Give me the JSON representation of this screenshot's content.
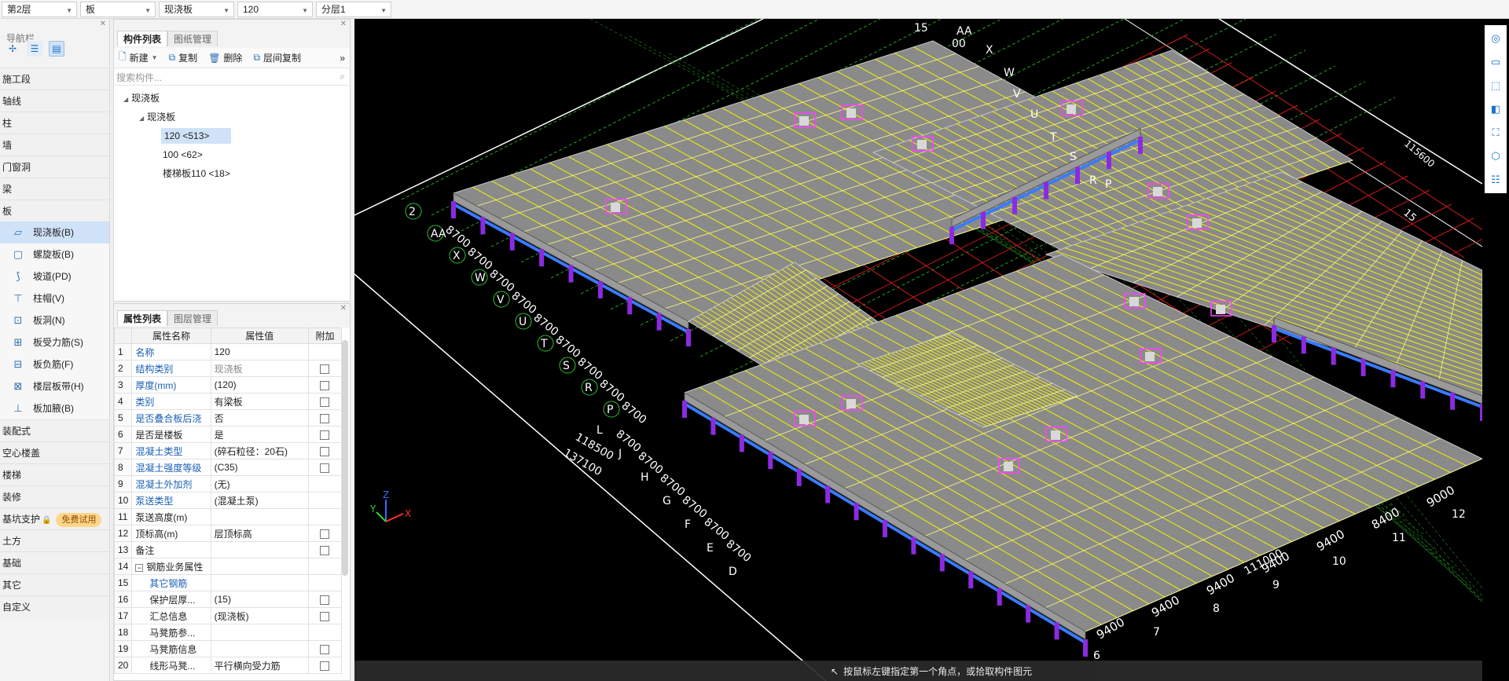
{
  "topbar": {
    "floor": "第2层",
    "category": "板",
    "type": "现浇板",
    "component": "120",
    "sublayer": "分层1"
  },
  "nav": {
    "title": "导航栏",
    "categories": [
      {
        "label": "施工段"
      },
      {
        "label": "轴线"
      },
      {
        "label": "柱"
      },
      {
        "label": "墙"
      },
      {
        "label": "门窗洞"
      },
      {
        "label": "梁"
      },
      {
        "label": "板"
      }
    ],
    "board_items": [
      {
        "label": "现浇板(B)",
        "icon": "slab-icon"
      },
      {
        "label": "螺旋板(B)",
        "icon": "spiral-slab-icon"
      },
      {
        "label": "坡道(PD)",
        "icon": "ramp-icon"
      },
      {
        "label": "柱帽(V)",
        "icon": "column-cap-icon"
      },
      {
        "label": "板洞(N)",
        "icon": "slab-hole-icon"
      },
      {
        "label": "板受力筋(S)",
        "icon": "slab-rebar-icon"
      },
      {
        "label": "板负筋(F)",
        "icon": "negative-rebar-icon"
      },
      {
        "label": "楼层板带(H)",
        "icon": "slab-strip-icon"
      },
      {
        "label": "板加腋(B)",
        "icon": "haunch-icon"
      }
    ],
    "more_categories": [
      {
        "label": "装配式"
      },
      {
        "label": "空心楼盖"
      },
      {
        "label": "楼梯"
      },
      {
        "label": "装修"
      },
      {
        "label": "基坑支护"
      },
      {
        "label": "土方"
      },
      {
        "label": "基础"
      },
      {
        "label": "其它"
      },
      {
        "label": "自定义"
      }
    ],
    "try_badge": "免费试用"
  },
  "complist": {
    "tab_active": "构件列表",
    "tab_other": "图纸管理",
    "new_label": "新建",
    "copy_label": "复制",
    "delete_label": "删除",
    "floor_copy_label": "层间复制",
    "search_placeholder": "搜索构件...",
    "tree": {
      "root": "现浇板",
      "child": "现浇板",
      "items": [
        "120 <513>",
        "100 <62>",
        "楼梯板110 <18>"
      ]
    }
  },
  "props": {
    "tab_active": "属性列表",
    "tab_other": "图层管理",
    "headers": {
      "name": "属性名称",
      "value": "属性值",
      "extra": "附加"
    },
    "rows": [
      {
        "n": "1",
        "name": "名称",
        "value": "120"
      },
      {
        "n": "2",
        "name": "结构类别",
        "value": "现浇板"
      },
      {
        "n": "3",
        "name": "厚度(mm)",
        "value": "(120)"
      },
      {
        "n": "4",
        "name": "类别",
        "value": "有梁板"
      },
      {
        "n": "5",
        "name": "是否叠合板后浇",
        "value": "否"
      },
      {
        "n": "6",
        "name": "是否是楼板",
        "value": "是"
      },
      {
        "n": "7",
        "name": "混凝土类型",
        "value": "(碎石粒径：20石)"
      },
      {
        "n": "8",
        "name": "混凝土强度等级",
        "value": "(C35)"
      },
      {
        "n": "9",
        "name": "混凝土外加剂",
        "value": "(无)"
      },
      {
        "n": "10",
        "name": "泵送类型",
        "value": "(混凝土泵)"
      },
      {
        "n": "11",
        "name": "泵送高度(m)",
        "value": ""
      },
      {
        "n": "12",
        "name": "顶标高(m)",
        "value": "层顶标高"
      },
      {
        "n": "13",
        "name": "备注",
        "value": ""
      },
      {
        "n": "14",
        "name": "钢筋业务属性",
        "value": ""
      },
      {
        "n": "15",
        "name": "其它钢筋",
        "value": ""
      },
      {
        "n": "16",
        "name": "保护层厚...",
        "value": "(15)"
      },
      {
        "n": "17",
        "name": "汇总信息",
        "value": "(现浇板)"
      },
      {
        "n": "18",
        "name": "马凳筋参...",
        "value": ""
      },
      {
        "n": "19",
        "name": "马凳筋信息",
        "value": ""
      },
      {
        "n": "20",
        "name": "线形马凳...",
        "value": "平行横向受力筋"
      }
    ]
  },
  "viewport": {
    "status_text": "按鼠标左键指定第一个角点，或拾取构件图元",
    "axis_labels": {
      "x": "X",
      "y": "Y",
      "z": "Z"
    },
    "grid_labels_left": [
      "2",
      "AA",
      "X",
      "W",
      "V",
      "U",
      "T",
      "S",
      "R",
      "P"
    ],
    "dims_left": [
      "8700",
      "8700",
      "8700",
      "8700",
      "8700",
      "8700",
      "8700",
      "8700",
      "8700"
    ],
    "grid_labels_top": [
      "15",
      "AA",
      "X",
      "W",
      "V",
      "U",
      "T",
      "S",
      "R",
      "P"
    ],
    "grid_labels_bottom": [
      "L",
      "J",
      "H",
      "G",
      "F",
      "E",
      "D"
    ],
    "dims_bottom": [
      "8700",
      "8700",
      "8700",
      "8700",
      "8700",
      "8700"
    ],
    "col_labels_bottom": [
      "6",
      "7",
      "8",
      "9",
      "10",
      "11",
      "12"
    ],
    "dims_row_bottom": [
      "9400",
      "9400",
      "9400",
      "9400",
      "9400",
      "8400",
      "9000"
    ],
    "special_dims": [
      "118500",
      "137100",
      "115600",
      "111000",
      "11000"
    ],
    "top_dim": "00",
    "right_dim": "15"
  },
  "colors": {
    "viewport_bg": "#000000",
    "slab_gray": "#8a8a8a",
    "beam_yellow": "#f2f200",
    "column_purple": "#8b2be0",
    "grid_green": "#2ec32e",
    "grid_red": "#d01a1a",
    "beam_blue": "#3a7bff"
  }
}
